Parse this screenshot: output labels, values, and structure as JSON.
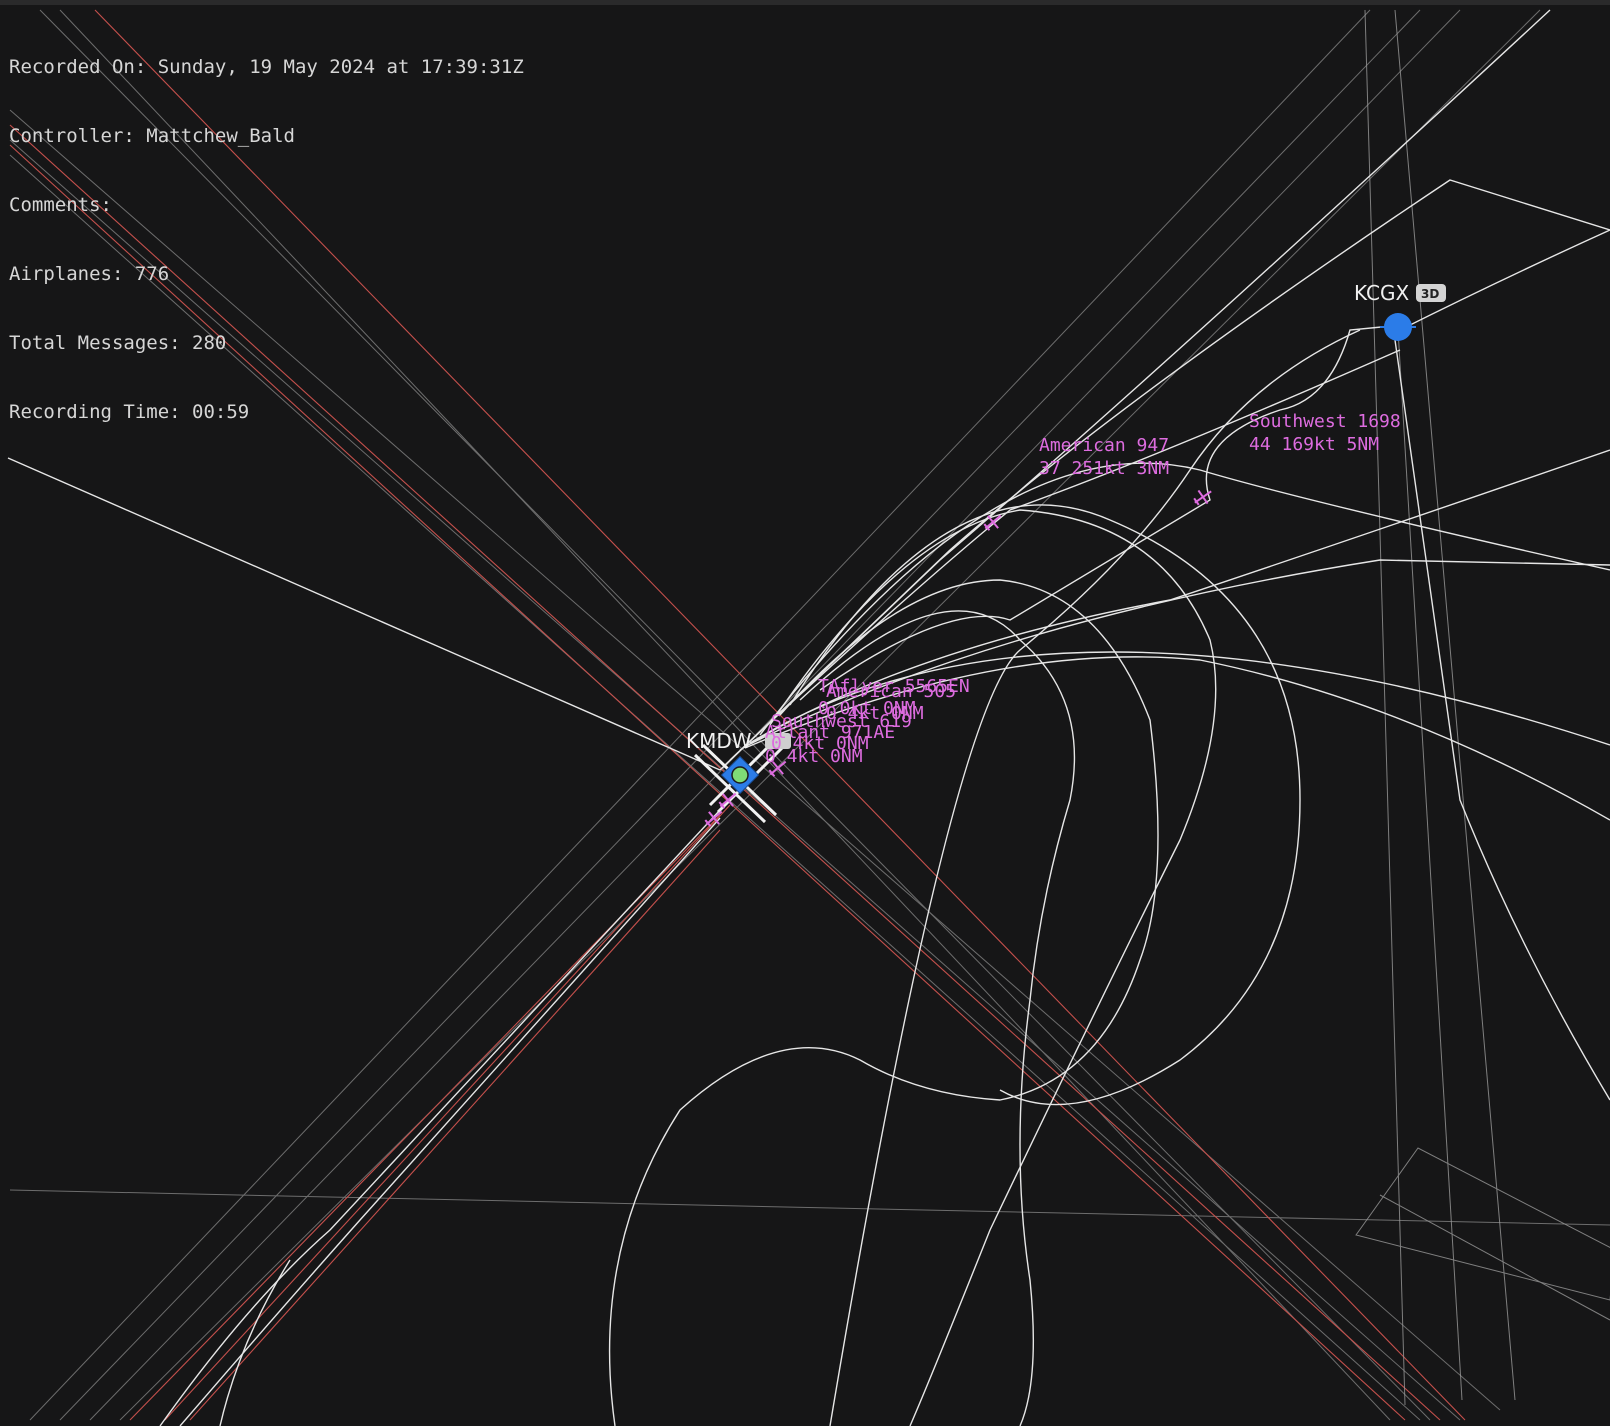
{
  "info": {
    "recorded_on": "Recorded On: Sunday, 19 May 2024 at 17:39:31Z",
    "controller": "Controller: Mattchew_Bald",
    "comments": "Comments:",
    "airplanes": "Airplanes: 776",
    "total_messages": "Total Messages: 280",
    "recording_time": "Recording Time: 00:59"
  },
  "airports": {
    "kmdw": {
      "label": "KMDW"
    },
    "kcgx": {
      "label": "KCGX",
      "badge": "3D"
    }
  },
  "aircraft_tags": {
    "american_947": {
      "line1": "American 947",
      "line2": "37 251kt 3NM"
    },
    "southwest_1698": {
      "line1": "Southwest 1698",
      "line2": "44 169kt 5NM"
    },
    "t_flyer_5565en": {
      "line1": "TAflyer 5565EN",
      "line2": "0 0kt 0NM"
    },
    "american_505": {
      "line1": "American 505",
      "line2": "0 4kt 0NM"
    },
    "southwest_619": {
      "line1": "Southwest 619",
      "line2": "0 4kt 0NM"
    },
    "atlant_971ae": {
      "line1": "Atlant 971AE",
      "line2": "0 4kt 0NM"
    }
  },
  "colors": {
    "background": "#161617",
    "track": "#e8e8e8",
    "faint_line": "#8a8a8a",
    "red_line": "#c4504c",
    "tag": "#dd6cdf",
    "airport_blue": "#2b7ce8",
    "airport_green": "#7fdc76"
  },
  "icons": [
    "airplane-icon",
    "airport-marker-icon"
  ]
}
